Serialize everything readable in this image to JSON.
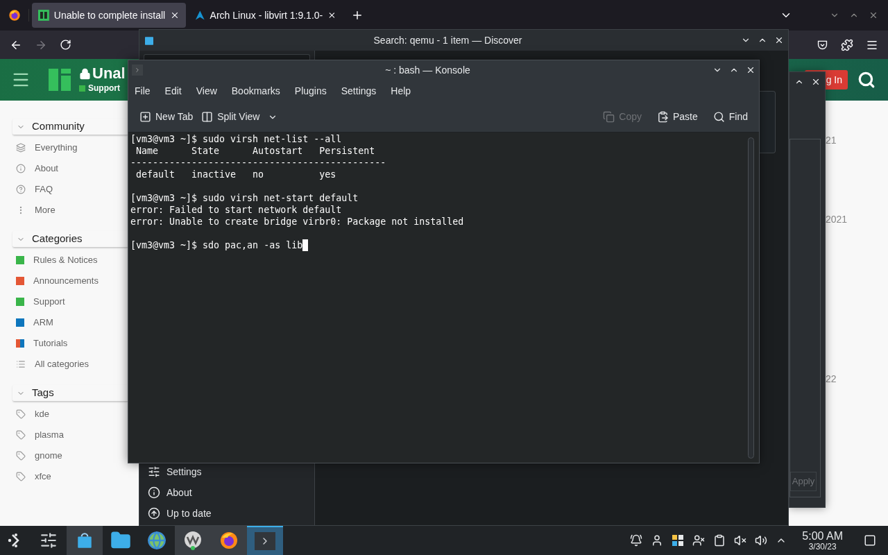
{
  "browser": {
    "tabs": [
      {
        "title": "Unable to complete install",
        "kind": "manjaro",
        "selected": true
      },
      {
        "title": "Arch Linux - libvirt 1:9.1.0-",
        "kind": "arch",
        "selected": false
      }
    ],
    "forward_disabled": true,
    "page": {
      "title": "Unal",
      "category": "Support",
      "login": "g In",
      "sidebar": [
        {
          "heading": "Community",
          "expanded": true,
          "items": [
            {
              "label": "Everything",
              "kind": "layers"
            },
            {
              "label": "About",
              "kind": "info"
            },
            {
              "label": "FAQ",
              "kind": "help"
            },
            {
              "label": "More",
              "kind": "more"
            }
          ]
        },
        {
          "heading": "Categories",
          "expanded": true,
          "items": [
            {
              "label": "Rules & Notices",
              "kind": "category",
              "color": "#3ab54a"
            },
            {
              "label": "Announcements",
              "kind": "category",
              "color": "#e45735"
            },
            {
              "label": "Support",
              "kind": "category",
              "color": "#3ab54a"
            },
            {
              "label": "ARM",
              "kind": "category",
              "color": "#0e76bd"
            },
            {
              "label": "Tutorials",
              "kind": "category",
              "color": "#e45735",
              "accent": {
                "color": "#0e76bd"
              }
            },
            {
              "label": "All categories",
              "kind": "list"
            }
          ]
        },
        {
          "heading": "Tags",
          "expanded": true,
          "items": [
            {
              "label": "kde",
              "kind": "tag"
            },
            {
              "label": "plasma",
              "kind": "tag"
            },
            {
              "label": "gnome",
              "kind": "tag"
            },
            {
              "label": "xfce",
              "kind": "tag"
            }
          ]
        }
      ],
      "dates": [
        "21",
        "2021",
        "22"
      ]
    }
  },
  "dialog": {
    "button": {
      "label": "Apply",
      "disabled": true
    }
  },
  "discover": {
    "title": "Search: qemu - 1 item — Discover",
    "nav": [
      {
        "label": "Settings",
        "kind": "settings"
      },
      {
        "label": "About",
        "kind": "about"
      },
      {
        "label": "Up to date",
        "kind": "updates"
      }
    ]
  },
  "konsole": {
    "title": "~ : bash — Konsole",
    "menu": [
      "File",
      "Edit",
      "View",
      "Bookmarks",
      "Plugins",
      "Settings",
      "Help"
    ],
    "toolbar_left": [
      {
        "label": "New Tab",
        "kind": "new-tab",
        "disabled": false
      },
      {
        "label": "Split View",
        "kind": "split",
        "disabled": false
      }
    ],
    "toolbar_right": [
      {
        "label": "Copy",
        "kind": "copy",
        "disabled": true
      },
      {
        "label": "Paste",
        "kind": "paste",
        "disabled": false
      },
      {
        "label": "Find",
        "kind": "find",
        "disabled": false
      }
    ],
    "blocks": [
      [
        "[vm3@vm3 ~]$ sudo virsh net-list --all",
        " Name      State      Autostart   Persistent",
        "----------------------------------------------",
        " default   inactive   no          yes"
      ],
      [
        "[vm3@vm3 ~]$ sudo virsh net-start default",
        "error: Failed to start network default",
        "error: Unable to create bridge virbr0: Package not installed"
      ],
      [
        "[vm3@vm3 ~]$ sdo pac,an -as lib"
      ]
    ],
    "cursor_visible": true
  },
  "taskbar": {
    "apps": [
      {
        "kind": "sliders",
        "open": false,
        "selected": false
      },
      {
        "kind": "discover",
        "open": true,
        "selected": false
      },
      {
        "kind": "files",
        "open": false,
        "selected": false
      },
      {
        "kind": "globe",
        "open": false,
        "selected": false
      },
      {
        "kind": "vm",
        "open": true,
        "selected": false
      },
      {
        "kind": "firefox",
        "open": true,
        "selected": false
      },
      {
        "kind": "konsole",
        "selected": true
      }
    ],
    "time": "5:00 AM",
    "date": "3/30/23"
  }
}
